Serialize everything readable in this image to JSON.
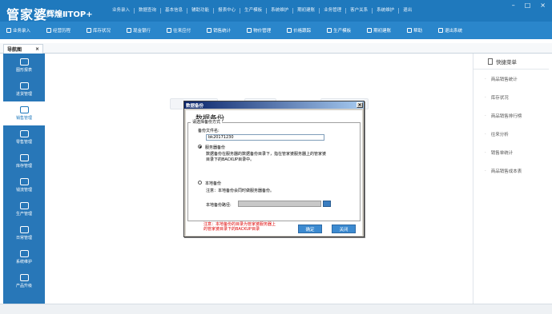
{
  "app": {
    "logo_text": "管家婆",
    "edition": "辉煌ⅡTOP+",
    "top_menu": [
      "业务录入",
      "数据查询",
      "基本信息",
      "辅助功能",
      "报表中心",
      "生产模板",
      "系统维护",
      "期初建账",
      "业务管理",
      "客户关系",
      "系统维护",
      "退出"
    ],
    "window_controls": [
      "–",
      "□",
      "×"
    ]
  },
  "toolbar": {
    "items": [
      {
        "icon": "entry-icon",
        "label": "业务录入"
      },
      {
        "icon": "report-icon",
        "label": "经营历程"
      },
      {
        "icon": "stock-icon",
        "label": "库存状况"
      },
      {
        "icon": "cash-icon",
        "label": "现金银行"
      },
      {
        "icon": "ledger-icon",
        "label": "往来应付"
      },
      {
        "icon": "sales-icon",
        "label": "销售统计"
      },
      {
        "icon": "goods-icon",
        "label": "物价管理"
      },
      {
        "icon": "chart-icon",
        "label": "价格跟踪"
      },
      {
        "icon": "tools-icon",
        "label": "生产模板"
      },
      {
        "icon": "book-icon",
        "label": "期初建账"
      },
      {
        "icon": "help-icon",
        "label": "帮助"
      },
      {
        "icon": "power-icon",
        "label": "退出系统"
      }
    ]
  },
  "tab": {
    "label": "导航图",
    "close": "×"
  },
  "sidebar": {
    "items": [
      {
        "icon": "grid-icon",
        "label": "图形报表",
        "active": false
      },
      {
        "icon": "cart-icon",
        "label": "进货管理",
        "active": false
      },
      {
        "icon": "trend-icon",
        "label": "销售管理",
        "active": true
      },
      {
        "icon": "tag-icon",
        "label": "零售管理",
        "active": false
      },
      {
        "icon": "home-icon",
        "label": "库存管理",
        "active": false
      },
      {
        "icon": "money-icon",
        "label": "钱流管理",
        "active": false
      },
      {
        "icon": "tools-icon",
        "label": "生产管理",
        "active": false
      },
      {
        "icon": "monitor-icon",
        "label": "日常管理",
        "active": false
      },
      {
        "icon": "wrench-icon",
        "label": "系统维护",
        "active": false
      },
      {
        "icon": "upload-icon",
        "label": "产品升级",
        "active": false
      }
    ]
  },
  "right_panel": {
    "title": "快捷菜单",
    "items": [
      "商品销售统计",
      "库存状况",
      "商品销售排行榜",
      "往来分析",
      "销售单统计",
      "商品销售成本表"
    ]
  },
  "dialog": {
    "title": "数据备份",
    "close": "×",
    "heading": "数据备份",
    "group_title": "请选择备份方式",
    "file_label": "备份文件名:",
    "file_value": "bk20171230",
    "server_backup_label": "服务器备份",
    "server_backup_checked": true,
    "server_backup_note": "数据备份在服务器的数据备份目录下，指在管家婆服务器上的管家婆目录下的BACKUP目录中。",
    "local_backup_label": "本地备份",
    "local_backup_checked": false,
    "local_backup_note": "注意：本地备份会同时做服务器备份。",
    "local_path_label": "本地备份路径:",
    "local_path_value": "",
    "footer_note": "注意：本地备份的目录为管家婆服务器上的管家婆目录下的BACKUP目录",
    "ok_label": "确定",
    "cancel_label": "关闭"
  },
  "colors": {
    "titlebar": "#1f79bd",
    "toolbar": "#2a86cb",
    "sidebar": "#2877b8",
    "button": "#3c8ad0",
    "warning_text": "#dd0000"
  }
}
